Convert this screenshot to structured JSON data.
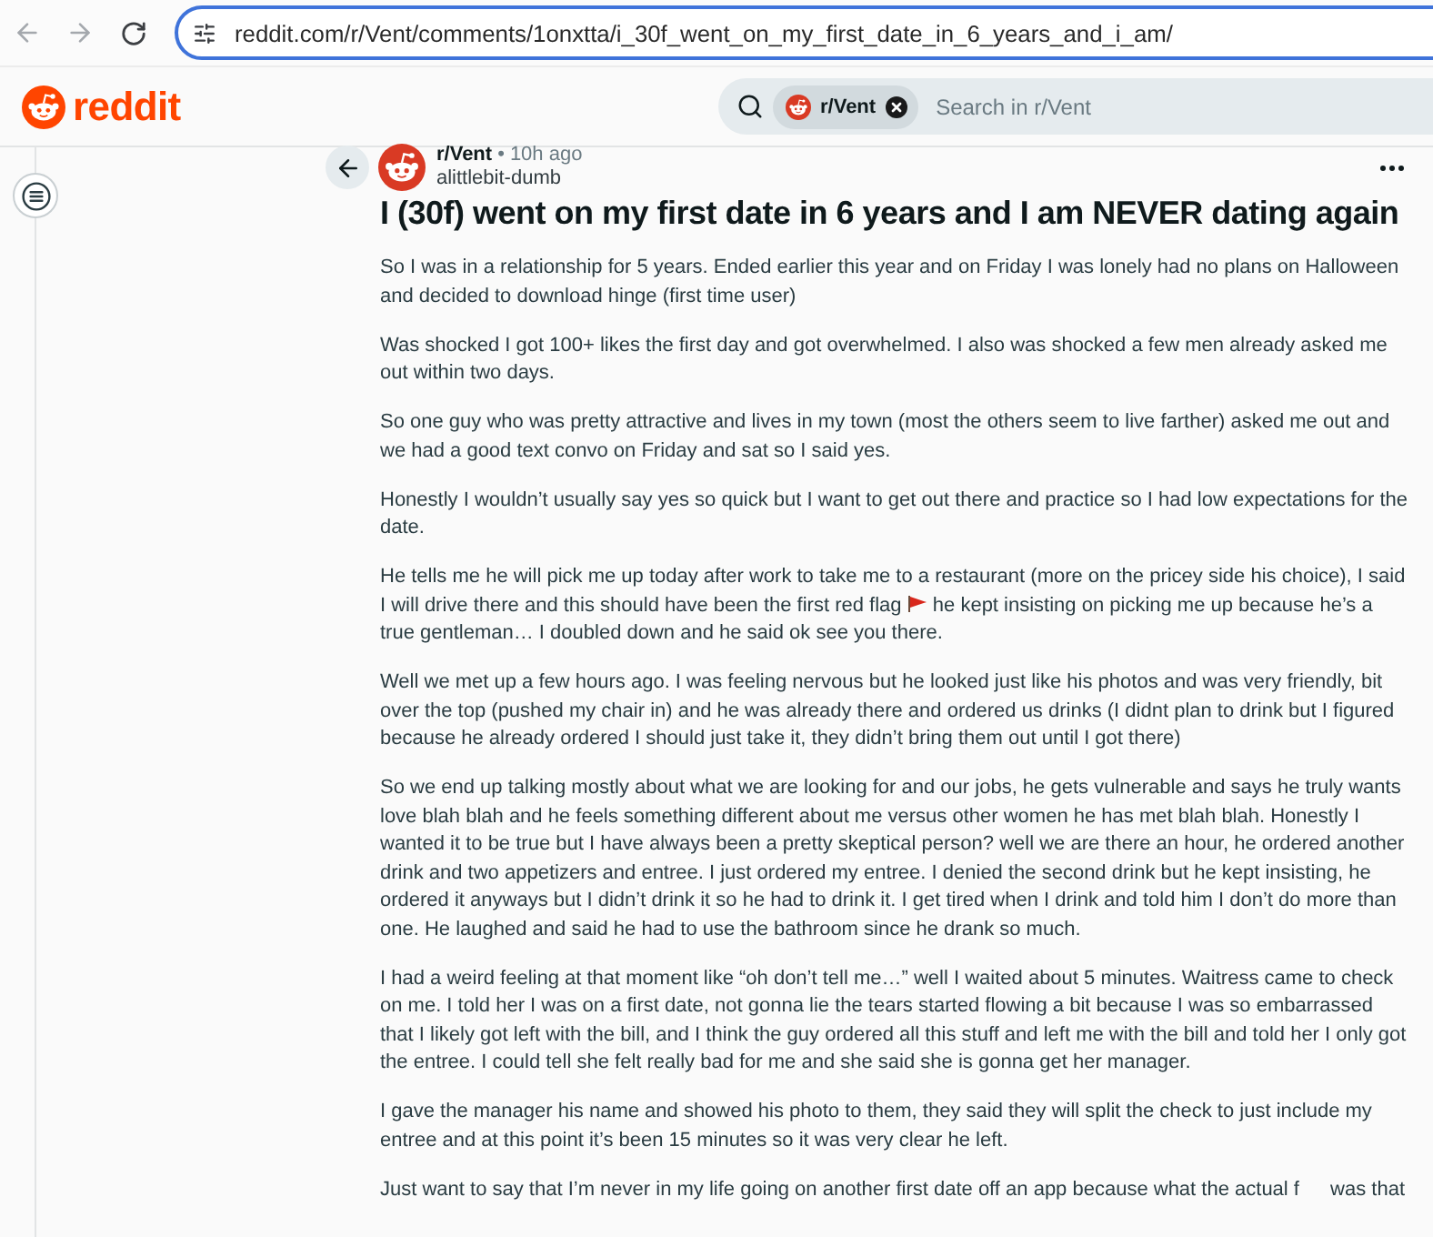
{
  "browser": {
    "back": {
      "disabled": true
    },
    "forward": {
      "disabled": true
    },
    "url": "reddit.com/r/Vent/comments/1onxtta/i_30f_went_on_my_first_date_in_6_years_and_i_am/"
  },
  "header": {
    "logo_text": "reddit",
    "search": {
      "chip": "r/Vent",
      "placeholder": "Search in r/Vent"
    }
  },
  "post": {
    "subreddit": "r/Vent",
    "separator": "•",
    "time": "10h ago",
    "author": "alittlebit-dumb",
    "title": "I (30f) went on my first date in 6 years and I am NEVER dating again",
    "paragraphs": [
      {
        "kind": "plain",
        "text": "So I was in a relationship for 5 years. Ended earlier this year and on Friday I was lonely had no plans on Halloween and decided to download hinge (first time user)"
      },
      {
        "kind": "plain",
        "text": "Was shocked I got 100+ likes the first day and got overwhelmed. I also was shocked a few men already asked me out within two days."
      },
      {
        "kind": "plain",
        "text": "So one guy who was pretty attractive and lives in my town (most the others seem to live farther) asked me out and we had a good text convo on Friday and sat so I said yes."
      },
      {
        "kind": "plain",
        "text": "Honestly I wouldn’t usually say yes so quick but I want to get out there and practice so I had low expectations for the date."
      },
      {
        "kind": "flag",
        "text": "He tells me he will pick me up today after work to take me to a restaurant (more on the pricey side his choice), I said I will drive there and this should have been the first red flag",
        "continuation": "he kept insisting on picking me up because he’s a true gentleman… I doubled down and he said ok see you there."
      },
      {
        "kind": "plain",
        "text": "Well we met up a few hours ago. I was feeling nervous but he looked just like his photos and was very friendly, bit over the top (pushed my chair in) and he was already there and ordered us drinks (I didnt plan to drink but I figured because he already ordered I should just take it, they didn’t bring them out until I got there)"
      },
      {
        "kind": "plain",
        "text": "So we end up talking mostly about what we are looking for and our jobs, he gets vulnerable and says he truly wants love blah blah and he feels something different about me versus other women he has met blah blah. Honestly I wanted it to be true but I have always been a pretty skeptical person? well we are there an hour, he ordered another drink and two appetizers and entree. I just ordered my entree. I denied the second drink but he kept insisting, he ordered it anyways but I didn’t drink it so he had to drink it. I get tired when I drink and told him I don’t do more than one. He laughed and said he had to use the bathroom since he drank so much."
      },
      {
        "kind": "plain",
        "text": "I had a weird feeling at that moment like “oh don’t tell me…” well I waited about 5 minutes. Waitress came to check on me. I told her I was on a first date, not gonna lie the tears started flowing a bit because I was so embarrassed that I likely got left with the bill, and I think the guy ordered all this stuff and left me with the bill and told her I only got the entree. I could tell she felt really bad for me and she said she is gonna get her manager."
      },
      {
        "kind": "plain",
        "text": "I gave the manager his name and showed his photo to them, they said they will split the check to just include my entree and at this point it’s been 15 minutes so it was very clear he left."
      },
      {
        "kind": "gap",
        "text": "Just want to say that I’m never in my life going on another first date off an app because what the actual f",
        "continuation": "was that"
      }
    ]
  }
}
